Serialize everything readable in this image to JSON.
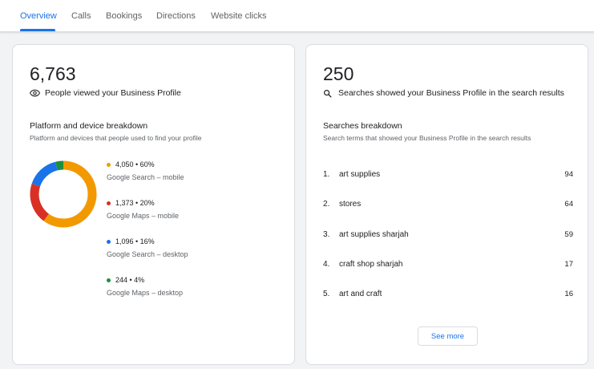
{
  "tabs": [
    {
      "label": "Overview",
      "active": true
    },
    {
      "label": "Calls"
    },
    {
      "label": "Bookings"
    },
    {
      "label": "Directions"
    },
    {
      "label": "Website clicks"
    }
  ],
  "profile_views": {
    "total": "6,763",
    "caption": "People viewed your Business Profile",
    "icon": "eye-icon",
    "breakdown_title": "Platform and device breakdown",
    "breakdown_subtitle": "Platform and devices that people used to find your profile",
    "items": [
      {
        "value": "4,050 • 60%",
        "label": "Google Search – mobile",
        "color": "#f29900",
        "fraction": 0.6
      },
      {
        "value": "1,373 • 20%",
        "label": "Google Maps – mobile",
        "color": "#d93025",
        "fraction": 0.2
      },
      {
        "value": "1,096 • 16%",
        "label": "Google Search – desktop",
        "color": "#1a73e8",
        "fraction": 0.16
      },
      {
        "value": "244 • 4%",
        "label": "Google Maps – desktop",
        "color": "#1e8e3e",
        "fraction": 0.04
      }
    ]
  },
  "searches": {
    "total": "250",
    "caption": "Searches showed your Business Profile in the search results",
    "icon": "search-icon",
    "breakdown_title": "Searches breakdown",
    "breakdown_subtitle": "Search terms that showed your Business Profile in the search results",
    "rows": [
      {
        "rank": "1.",
        "term": "art supplies",
        "count": "94"
      },
      {
        "rank": "2.",
        "term": "stores",
        "count": "64"
      },
      {
        "rank": "3.",
        "term": "art supplies sharjah",
        "count": "59"
      },
      {
        "rank": "4.",
        "term": "craft shop sharjah",
        "count": "17"
      },
      {
        "rank": "5.",
        "term": "art and craft",
        "count": "16"
      }
    ],
    "see_more_label": "See more"
  }
}
